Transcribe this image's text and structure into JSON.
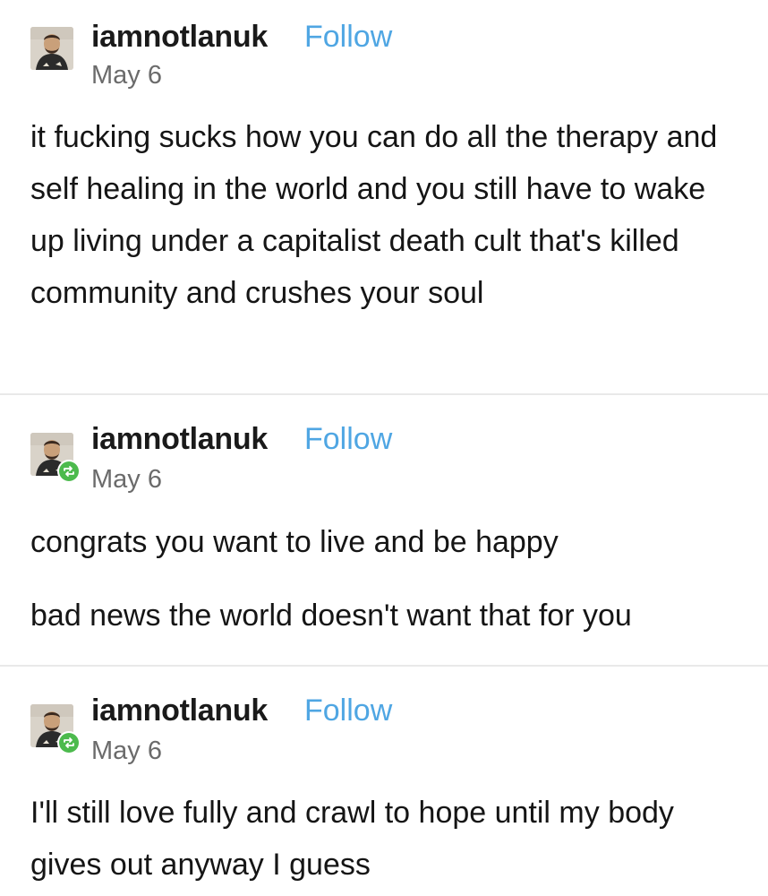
{
  "posts": [
    {
      "username": "iamnotlanuk",
      "follow_label": "Follow",
      "date": "May 6",
      "reblog": false,
      "paragraphs": [
        "it fucking sucks how you can do all the therapy and self healing in the world and you still have to wake up living under a capitalist death cult that's killed community and crushes your soul"
      ]
    },
    {
      "username": "iamnotlanuk",
      "follow_label": "Follow",
      "date": "May 6",
      "reblog": true,
      "paragraphs": [
        "congrats you want to live and be happy",
        "bad news the world doesn't want that for you"
      ]
    },
    {
      "username": "iamnotlanuk",
      "follow_label": "Follow",
      "date": "May 6",
      "reblog": true,
      "paragraphs": [
        "I'll still love fully and crawl to hope until my body gives out anyway I guess"
      ]
    }
  ],
  "colors": {
    "follow": "#4fa6e3",
    "reblog_badge": "#4cba4d",
    "divider": "#e9e9e9",
    "date": "#6b6b6b"
  },
  "icons": {
    "avatar": "user-photo-avatar",
    "reblog": "reblog-arrows-icon"
  }
}
